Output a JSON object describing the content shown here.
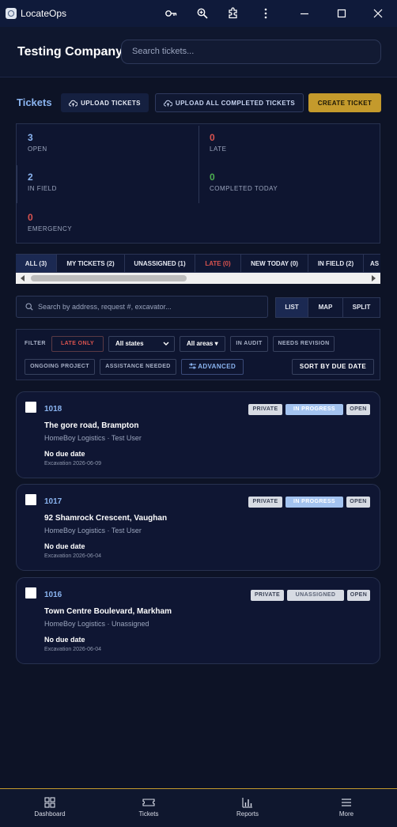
{
  "window": {
    "title": "LocateOps"
  },
  "header": {
    "company": "Testing Company",
    "search_placeholder": "Search tickets..."
  },
  "tickets_section": {
    "title": "Tickets",
    "upload_label": "UPLOAD TICKETS",
    "upload_all_label": "UPLOAD ALL COMPLETED TICKETS",
    "create_label": "CREATE TICKET"
  },
  "stats": [
    {
      "value": "3",
      "label": "OPEN",
      "color": "#8ab4f0"
    },
    {
      "value": "0",
      "label": "LATE",
      "color": "#d9534f"
    },
    {
      "value": "2",
      "label": "IN FIELD",
      "color": "#8ab4f0"
    },
    {
      "value": "0",
      "label": "COMPLETED TODAY",
      "color": "#4caf50"
    },
    {
      "value": "0",
      "label": "EMERGENCY",
      "color": "#d9534f"
    }
  ],
  "tabs": [
    "ALL (3)",
    "MY TICKETS (2)",
    "UNASSIGNED (1)",
    "LATE (0)",
    "NEW TODAY (0)",
    "IN FIELD (2)",
    "AS"
  ],
  "search2": {
    "placeholder": "Search by address, request #, excavator..."
  },
  "view_modes": [
    "LIST",
    "MAP",
    "SPLIT"
  ],
  "filters": {
    "label": "FILTER",
    "late_only": "LATE ONLY",
    "states": "All states",
    "areas": "All areas ▾",
    "in_audit": "IN AUDIT",
    "needs_revision": "NEEDS REVISION",
    "ongoing": "ONGOING PROJECT",
    "assistance": "ASSISTANCE NEEDED",
    "advanced": "ADVANCED",
    "sort": "SORT BY DUE DATE"
  },
  "tickets": [
    {
      "id": "1018",
      "address": "The gore road, Brampton",
      "company": "HomeBoy Logistics · Test User",
      "due": "No due date",
      "excavation": "Excavation 2026-06-09",
      "badges": [
        "PRIVATE",
        "IN PROGRESS",
        "OPEN"
      ]
    },
    {
      "id": "1017",
      "address": "92 Shamrock Crescent, Vaughan",
      "company": "HomeBoy Logistics · Test User",
      "due": "No due date",
      "excavation": "Excavation 2026-06-04",
      "badges": [
        "PRIVATE",
        "IN PROGRESS",
        "OPEN"
      ]
    },
    {
      "id": "1016",
      "address": "Town Centre Boulevard, Markham",
      "company": "HomeBoy Logistics · Unassigned",
      "due": "No due date",
      "excavation": "Excavation 2026-06-04",
      "badges": [
        "PRIVATE",
        "UNASSIGNED",
        "OPEN"
      ]
    }
  ],
  "nav": [
    "Dashboard",
    "Tickets",
    "Reports",
    "More"
  ],
  "colors": {
    "accent": "#c49a2c",
    "link": "#8ab4f0",
    "danger": "#d9534f",
    "success": "#4caf50"
  }
}
